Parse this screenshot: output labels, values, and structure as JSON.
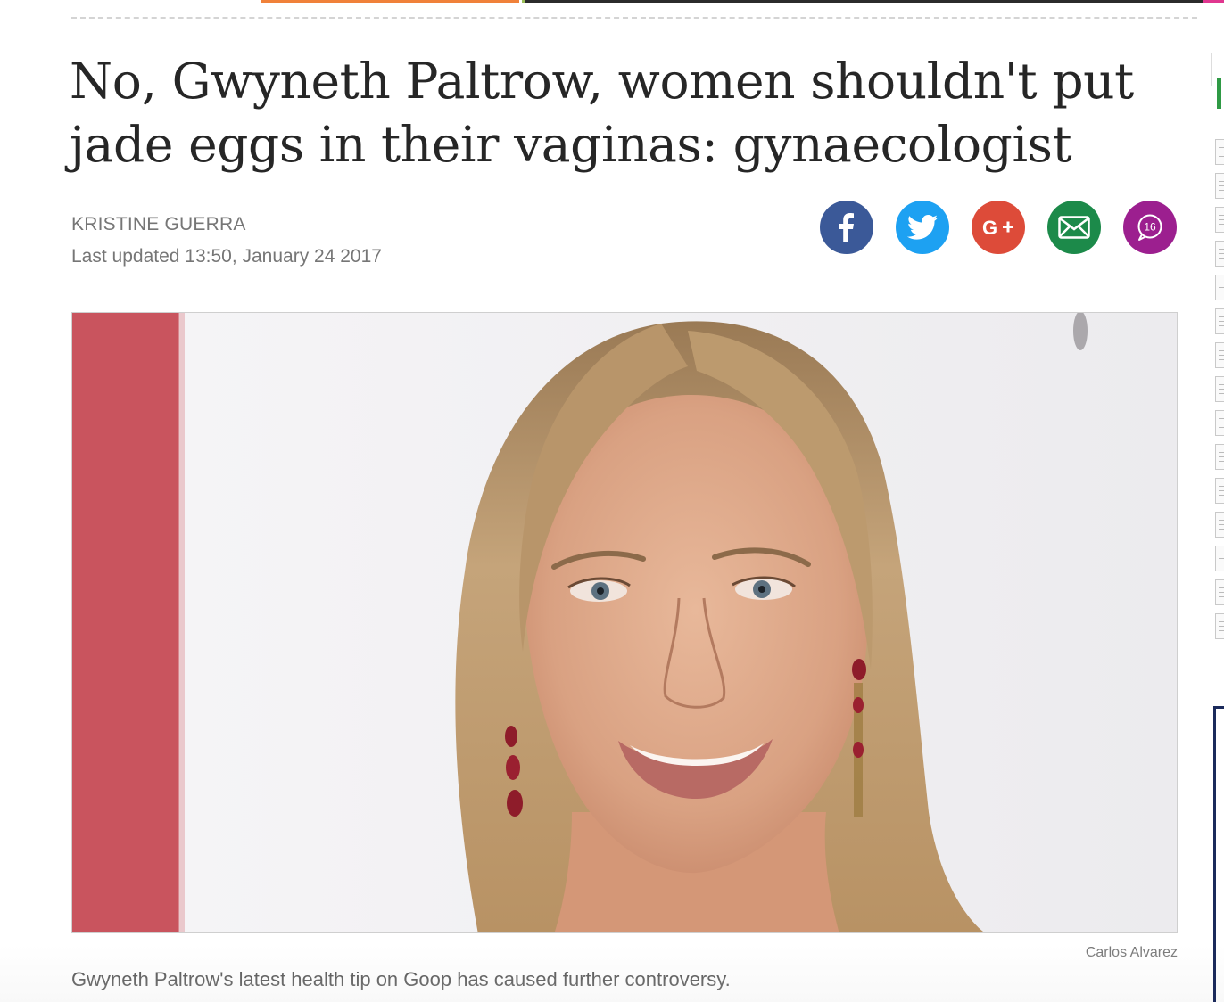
{
  "article": {
    "headline": "No, Gwyneth Paltrow, women shouldn't put jade eggs in their vaginas: gynaecologist",
    "author": "KRISTINE GUERRA",
    "last_updated": "Last updated 13:50, January 24 2017"
  },
  "share": {
    "buttons": [
      {
        "name": "facebook",
        "color": "#3b5998",
        "icon": "facebook-icon"
      },
      {
        "name": "twitter",
        "color": "#1da1f2",
        "icon": "twitter-bird-icon"
      },
      {
        "name": "google-plus",
        "color": "#dd4b39",
        "icon": "google-plus-icon"
      },
      {
        "name": "email",
        "color": "#1c8a4a",
        "icon": "envelope-icon"
      },
      {
        "name": "comments",
        "color": "#9c1f8f",
        "icon": "speech-bubble-icon"
      }
    ],
    "comment_count": "16"
  },
  "hero_image": {
    "photo_credit": "Carlos Alvarez",
    "caption": "Gwyneth Paltrow's latest health tip on Goop has caused further controversy."
  },
  "colors": {
    "accent_orange": "#f0813a",
    "sidebar_green": "#2f9a45",
    "text_gray": "#767676"
  }
}
